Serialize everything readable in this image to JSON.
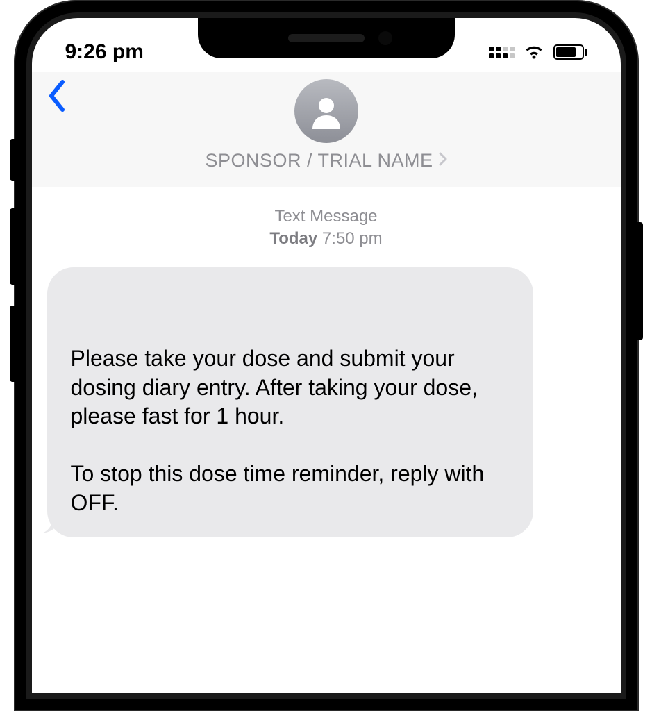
{
  "status": {
    "time": "9:26 pm"
  },
  "header": {
    "contact_name": "SPONSOR / TRIAL NAME"
  },
  "thread": {
    "meta_label": "Text Message",
    "meta_day": "Today",
    "meta_time": "7:50 pm",
    "message": "Please take your dose and submit your dosing diary entry. After taking your dose, please fast for 1 hour.\n\nTo stop this dose time reminder, reply with OFF."
  }
}
